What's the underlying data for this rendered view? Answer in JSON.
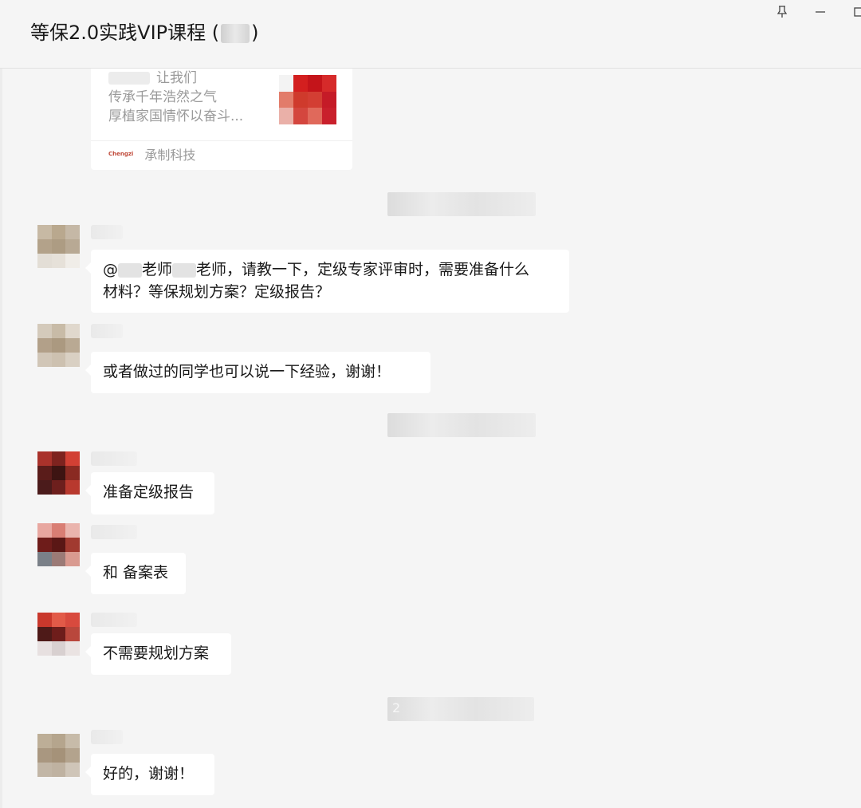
{
  "header": {
    "title": "等保2.0实践VIP课程",
    "title_paren_open": "(",
    "title_paren_close": ")"
  },
  "window_controls": {
    "pin_icon": "pin-icon",
    "minimize_icon": "minimize-icon",
    "maximize_icon": "maximize-icon"
  },
  "link_card": {
    "line1": "让我们",
    "line2": "传承千年浩然之气",
    "line3": "厚植家国情怀以奋斗...",
    "source_logo": "Chengzi",
    "source_name": "承制科技"
  },
  "timestamps": {
    "third_visible_digit": "2"
  },
  "messages": [
    {
      "id": "m1",
      "text_line1_a": "@",
      "text_line1_b": "老师",
      "text_line1_c": "老师，请教一下，定级专家评审时，需要准备什么",
      "text_line2": "材料？等保规划方案？定级报告？"
    },
    {
      "id": "m2",
      "text": "或者做过的同学也可以说一下经验，谢谢！"
    },
    {
      "id": "m3",
      "text": "准备定级报告"
    },
    {
      "id": "m4",
      "text": "和 备案表"
    },
    {
      "id": "m5",
      "text": "不需要规划方案"
    },
    {
      "id": "m6",
      "text": "好的，谢谢！"
    }
  ],
  "colors": {
    "background": "#f5f5f5",
    "bubble": "#ffffff",
    "text": "#191919",
    "muted": "#9a9a9a"
  }
}
